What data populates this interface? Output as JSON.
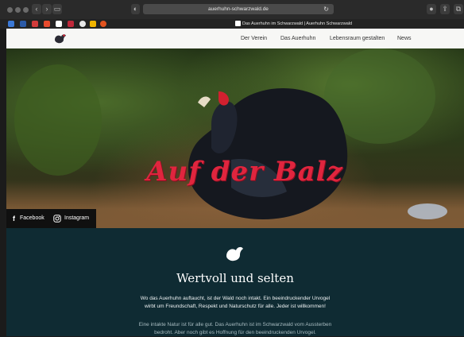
{
  "browser": {
    "url": "auerhuhn-schwarzwald.de",
    "tab_title": "Das Auerhuhn im Schwarzwald | Auerhuhn Schwarzwald"
  },
  "nav": {
    "items": [
      "Der Verein",
      "Das Auerhuhn",
      "Lebensraum gestalten",
      "News"
    ]
  },
  "hero": {
    "title": "Auf der Balz",
    "social": {
      "facebook": "Facebook",
      "instagram": "Instagram"
    }
  },
  "content": {
    "heading": "Wertvoll und selten",
    "paragraph1": [
      "Wo das Auerhuhn auftaucht, ist der Wald noch intakt. Ein beeindruckender Urvogel",
      "wirbt um Freundschaft, Respekt und Naturschutz für alle. Jeder ist willkommen!"
    ],
    "paragraph2": [
      "Eine intakte Natur ist für alle gut. Das Auerhuhn ist im Schwarzwald vom Aussterben",
      "bedroht. Aber noch gibt es Hoffnung für den beeindruckenden Urvogel."
    ]
  },
  "colors": {
    "title_red": "#e0253e",
    "section_bg": "#0f2b33",
    "nav_bg": "#f7f7f5"
  }
}
